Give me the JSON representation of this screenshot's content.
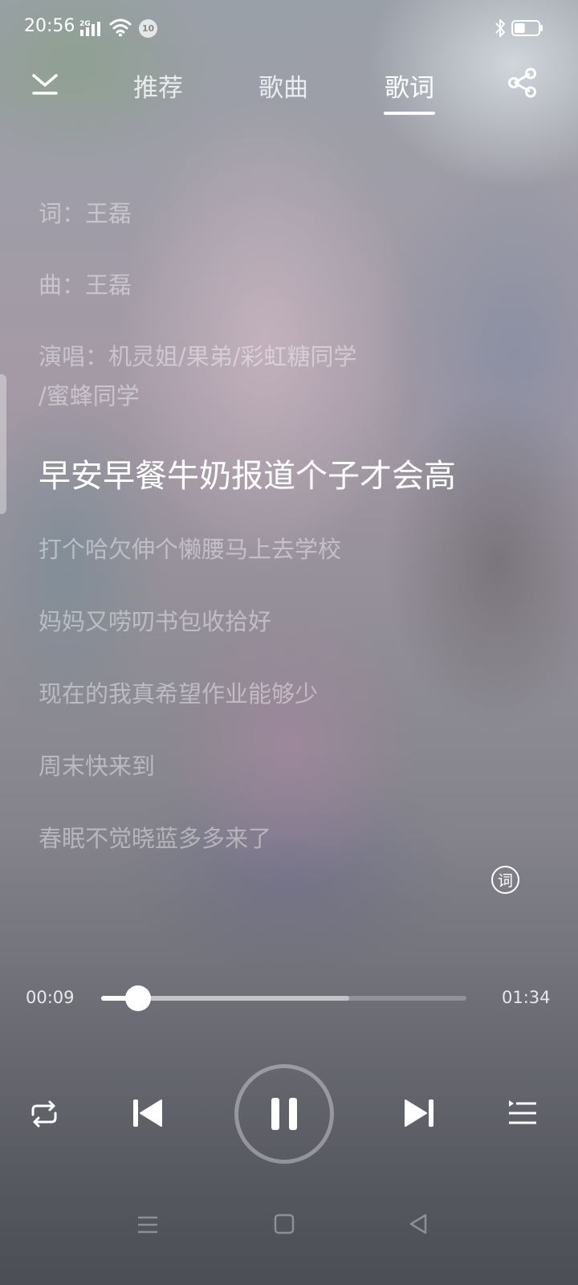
{
  "status_bar": {
    "time": "20:56",
    "network": "2G",
    "notification_count": "10",
    "icons": [
      "signal-icon",
      "wifi-icon",
      "bluetooth-icon",
      "battery-icon"
    ],
    "battery_level": 0.45
  },
  "header": {
    "tabs": [
      {
        "label": "推荐",
        "active": false
      },
      {
        "label": "歌曲",
        "active": false
      },
      {
        "label": "歌词",
        "active": true
      }
    ]
  },
  "lyrics": {
    "lines": [
      "词：王磊",
      "曲：王磊",
      "演唱：机灵姐/果弟/彩虹糖同学",
      "/蜜蜂同学",
      "早安早餐牛奶报道个子才会高",
      "打个哈欠伸个懒腰马上去学校",
      "妈妈又唠叨书包收拾好",
      "现在的我真希望作业能够少",
      "周末快来到",
      "春眠不觉晓蓝多多来了"
    ],
    "current_index": 4,
    "badge": "词"
  },
  "player": {
    "current_time": "00:09",
    "total_time": "01:34",
    "progress": 0.1,
    "buffered": 0.68,
    "state": "playing"
  },
  "colors": {
    "text_active": "#ffffff",
    "text_inactive": "rgba(255,255,255,0.42)"
  }
}
